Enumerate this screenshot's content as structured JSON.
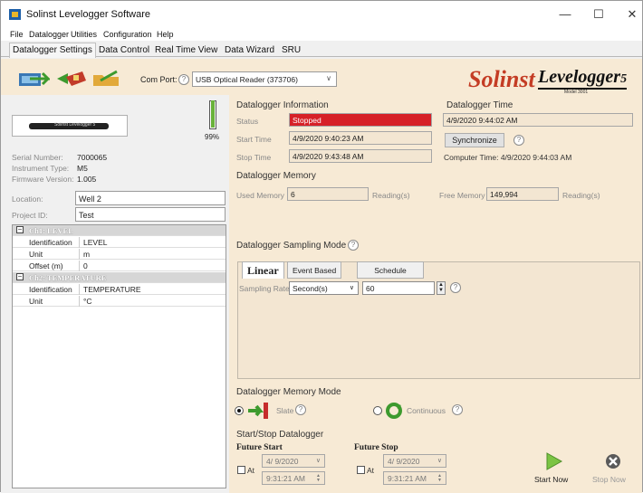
{
  "window": {
    "title": "Solinst Levelogger Software"
  },
  "menu": [
    "File",
    "Datalogger",
    "Utilities",
    "Configuration",
    "Help"
  ],
  "tabs": [
    "Datalogger Settings",
    "Data Control",
    "Real Time View",
    "Data Wizard",
    "SRU"
  ],
  "toolbar": {
    "com_port_label": "Com Port:",
    "com_port_value": "USB Optical Reader (373706)",
    "logo_brand": "Solinst",
    "logo_product": "Levelogger",
    "logo_version": "5",
    "logo_model": "Model 3001"
  },
  "device": {
    "image_label": "Solinst Levelogger 5",
    "battery_pct": "99%",
    "battery_level": 0.99,
    "serial_label": "Serial Number:",
    "serial_value": "7000065",
    "type_label": "Instrument Type:",
    "type_value": "M5",
    "firmware_label": "Firmware Version:",
    "firmware_value": "1.005",
    "location_label": "Location:",
    "location_value": "Well 2",
    "project_label": "Project ID:",
    "project_value": "Test"
  },
  "channels": [
    {
      "name": "Ch1: LEVEL",
      "rows": [
        [
          "Identification",
          "LEVEL"
        ],
        [
          "Unit",
          "m"
        ],
        [
          "Offset (m)",
          "0"
        ]
      ]
    },
    {
      "name": "Ch2: TEMPERATURE",
      "rows": [
        [
          "Identification",
          "TEMPERATURE"
        ],
        [
          "Unit",
          "°C"
        ]
      ]
    }
  ],
  "datalogger_info": {
    "title": "Datalogger Information",
    "status_label": "Status",
    "status_value": "Stopped",
    "start_label": "Start Time",
    "start_value": "4/9/2020 9:40:23 AM",
    "stop_label": "Stop Time",
    "stop_value": "4/9/2020 9:43:48 AM"
  },
  "datalogger_time": {
    "title": "Datalogger Time",
    "value": "4/9/2020 9:44:02 AM",
    "sync_label": "Synchronize",
    "computer_time": "Computer Time: 4/9/2020 9:44:03 AM"
  },
  "memory": {
    "title": "Datalogger Memory",
    "used_label": "Used Memory",
    "used_value": "6",
    "used_unit": "Reading(s)",
    "free_label": "Free Memory",
    "free_value": "149,994",
    "free_unit": "Reading(s)"
  },
  "sampling": {
    "title": "Datalogger Sampling Mode",
    "tabs": [
      "Linear",
      "Event Based",
      "Schedule"
    ],
    "rate_label": "Sampling Rate",
    "rate_unit": "Second(s)",
    "rate_value": "60"
  },
  "memory_mode": {
    "title": "Datalogger Memory Mode",
    "slate_label": "Slate",
    "continuous_label": "Continuous"
  },
  "start_stop": {
    "title": "Start/Stop Datalogger",
    "future_start": "Future Start",
    "future_stop": "Future Stop",
    "at_label": "At",
    "start_date": "4/ 9/2020",
    "start_time": "9:31:21 AM",
    "stop_date": "4/ 9/2020",
    "stop_time": "9:31:21 AM",
    "start_now": "Start Now",
    "stop_now": "Stop Now"
  },
  "colors": {
    "accent_panel": "#f7ead5",
    "status_red": "#d62027",
    "logo_red": "#c43c24"
  }
}
